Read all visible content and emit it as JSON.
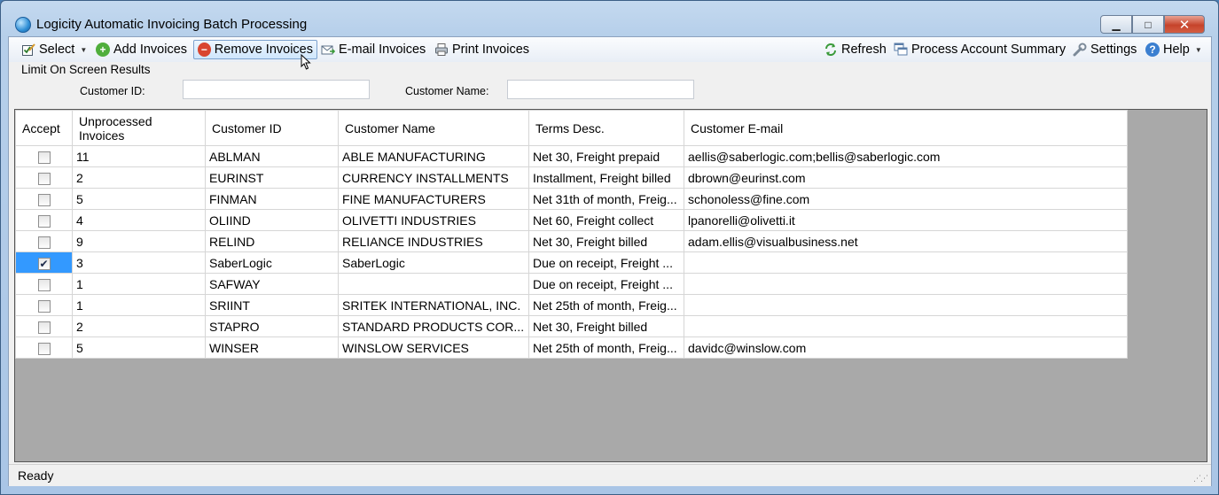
{
  "window": {
    "title": "Logicity Automatic Invoicing Batch Processing",
    "minimize_glyph": "▁",
    "maximize_glyph": "□",
    "close_glyph": "✕"
  },
  "toolbar": {
    "select_label": "Select",
    "add_label": "Add Invoices",
    "remove_label": "Remove Invoices",
    "email_label": "E-mail Invoices",
    "print_label": "Print Invoices",
    "refresh_label": "Refresh",
    "summary_label": "Process Account Summary",
    "settings_label": "Settings",
    "help_label": "Help"
  },
  "filter": {
    "legend": "Limit On Screen Results",
    "customer_id_label": "Customer ID:",
    "customer_id_value": "",
    "customer_name_label": "Customer Name:",
    "customer_name_value": ""
  },
  "grid": {
    "columns": [
      "Accept",
      "Unprocessed Invoices",
      "Customer ID",
      "Customer Name",
      "Terms Desc.",
      "Customer E-mail"
    ],
    "rows": [
      {
        "accept": false,
        "unprocessed": "11",
        "customer_id": "ABLMAN",
        "customer_name": "ABLE MANUFACTURING",
        "terms": "Net 30, Freight prepaid",
        "email": "aellis@saberlogic.com;bellis@saberlogic.com"
      },
      {
        "accept": false,
        "unprocessed": "2",
        "customer_id": "EURINST",
        "customer_name": "CURRENCY INSTALLMENTS",
        "terms": "Installment, Freight billed",
        "email": "dbrown@eurinst.com"
      },
      {
        "accept": false,
        "unprocessed": "5",
        "customer_id": "FINMAN",
        "customer_name": "FINE MANUFACTURERS",
        "terms": "Net 31th of month, Freig...",
        "email": "schonoless@fine.com"
      },
      {
        "accept": false,
        "unprocessed": "4",
        "customer_id": "OLIIND",
        "customer_name": "OLIVETTI INDUSTRIES",
        "terms": "Net 60, Freight collect",
        "email": "lpanorelli@olivetti.it"
      },
      {
        "accept": false,
        "unprocessed": "9",
        "customer_id": "RELIND",
        "customer_name": "RELIANCE INDUSTRIES",
        "terms": "Net 30, Freight billed",
        "email": "adam.ellis@visualbusiness.net"
      },
      {
        "accept": true,
        "unprocessed": "3",
        "customer_id": "SaberLogic",
        "customer_name": "SaberLogic",
        "terms": "Due on receipt, Freight ...",
        "email": ""
      },
      {
        "accept": false,
        "unprocessed": "1",
        "customer_id": "SAFWAY",
        "customer_name": "",
        "terms": "Due on receipt, Freight ...",
        "email": ""
      },
      {
        "accept": false,
        "unprocessed": "1",
        "customer_id": "SRIINT",
        "customer_name": "SRITEK INTERNATIONAL, INC.",
        "terms": "Net 25th of month, Freig...",
        "email": ""
      },
      {
        "accept": false,
        "unprocessed": "2",
        "customer_id": "STAPRO",
        "customer_name": "STANDARD PRODUCTS COR...",
        "terms": "Net 30, Freight billed",
        "email": ""
      },
      {
        "accept": false,
        "unprocessed": "5",
        "customer_id": "WINSER",
        "customer_name": "WINSLOW SERVICES",
        "terms": "Net 25th of month, Freig...",
        "email": "davidc@winslow.com"
      }
    ]
  },
  "status": {
    "text": "Ready"
  },
  "icons": {
    "select": "checkbox-edit-icon",
    "add": "plus-circle-icon",
    "remove": "minus-circle-icon",
    "email": "envelope-arrow-icon",
    "print": "printer-icon",
    "refresh": "refresh-icon",
    "summary": "windows-stack-icon",
    "settings": "wrench-icon",
    "help": "question-circle-icon"
  },
  "colors": {
    "selection": "#3399ff",
    "hover_border": "#7da2ce",
    "close_button": "#c6432b"
  }
}
